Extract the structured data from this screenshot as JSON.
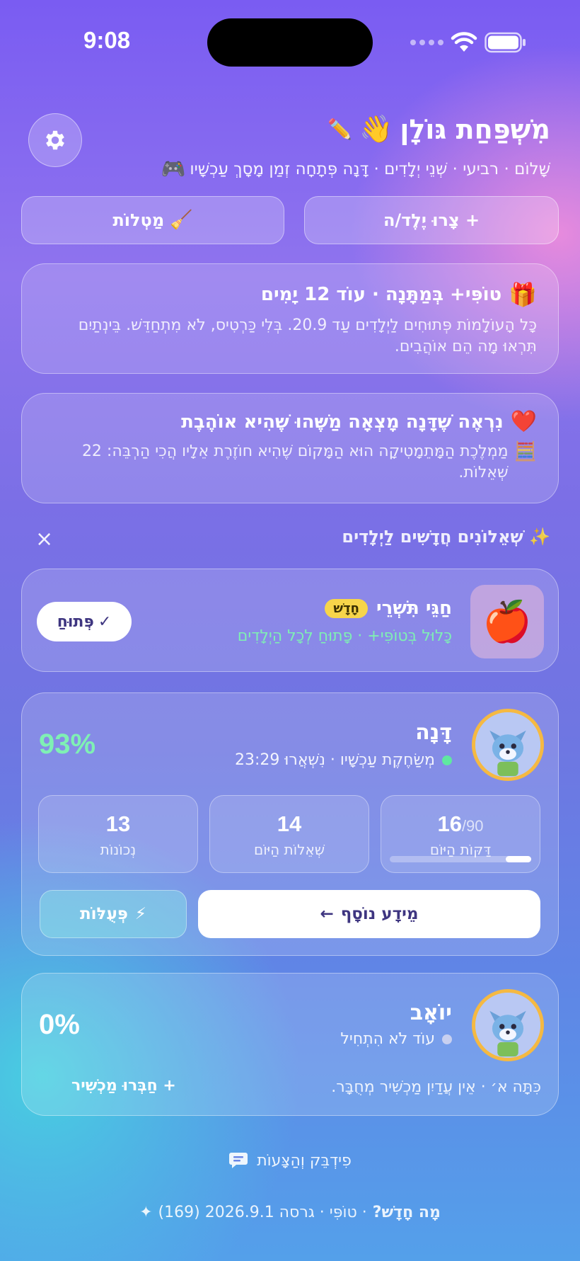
{
  "status": {
    "time": "9:08"
  },
  "header": {
    "title": "מִשְׁפַּחַת גּוֹלָן",
    "subtitle": "שָׁלוֹם · רביעי · שְׁנֵי יְלָדִים · דָּנָה פְּתָחָה זְמַן מָסָךְ עַכְשָׁיו"
  },
  "actions": {
    "add_child": "+ צָרוּ יֶלֶד/ה",
    "tasks": "מַטְלוֹת"
  },
  "promo_card": {
    "title": "טוֹפִּי+ בְּמַתָּנָה · עוֹד 12 יָמִים",
    "body": "כָּל הָעוֹלָמוֹת פְּתוּחִים לַיְלָדִים עַד 20.9. בְּלִי כַּרְטִיס, לֹא מִתְחַדֵּשׁ. בֵּינְתַיִם תִּרְאוּ מָה הֵם אוֹהֲבִים."
  },
  "insight_card": {
    "title": "נִרְאֶה שֶׁדָּנָה מָצְאָה מַשֶּׁהוּ שֶׁהִיא אוֹהֶבֶת",
    "body": "מַמְלֶכֶת הַמָּתֵמָטִיקָה הוּא הַמָּקוֹם שֶׁהִיא חוֹזֶרֶת אֵלָיו הֲכִי הַרְבֵּה: 22 שְׁאֵלוֹת."
  },
  "new_quizzes": {
    "heading": "שְׁאֵלוֹנִים חֲדָשִׁים לַיְלָדִים",
    "close": "×",
    "item": {
      "title": "חַגֵּי תִּשְׁרֵי",
      "badge": "חָדָשׁ",
      "subtitle": "כָּלוּל בְּטוֹפִּי+ · פָּתוּחַ לְכָל הַיְלָדִים",
      "button": "פְּתוּחַ"
    }
  },
  "children": [
    {
      "name": "דָּנָה",
      "status": "מְשַׂחֶקֶת עַכְשָׁיו · נִשְׁאֲרוּ 23:29",
      "status_color": "#5fe8a0",
      "percent": "93%",
      "stats": [
        {
          "num": "16",
          "den": "/90",
          "label": "דַּקּוֹת הַיּוֹם",
          "progress": 0.18
        },
        {
          "num": "14",
          "label": "שְׁאֵלוֹת הַיּוֹם"
        },
        {
          "num": "13",
          "label": "נְכוֹנוֹת"
        }
      ],
      "more_button": "מֵידָע נוֹסָף",
      "actions_button": "פְּעֻלּוֹת"
    },
    {
      "name": "יוֹאָב",
      "status": "עוֹד לֹא הִתְחִיל",
      "status_color": "#c8d0f0",
      "percent": "0%",
      "note": "כִּתָּה א׳ · אֵין עֲדַיִן מַכְשִׁיר מְחֻבָּר.",
      "connect_button": "+ חַבְּרוּ מַכְשִׁיר"
    }
  ],
  "footer": {
    "feedback": "פִידְבֵּק וְהַצָּעוֹת",
    "whats_new": "מָה חָדָשׁ?",
    "version": "· טוֹפִּי · גרסה 2026.9.1 (169)"
  },
  "colors": {
    "accent_green": "#5fe8a0",
    "badge_yellow": "#f7d54a",
    "avatar_ring": "#f5b942",
    "button_text": "#3e3580"
  }
}
